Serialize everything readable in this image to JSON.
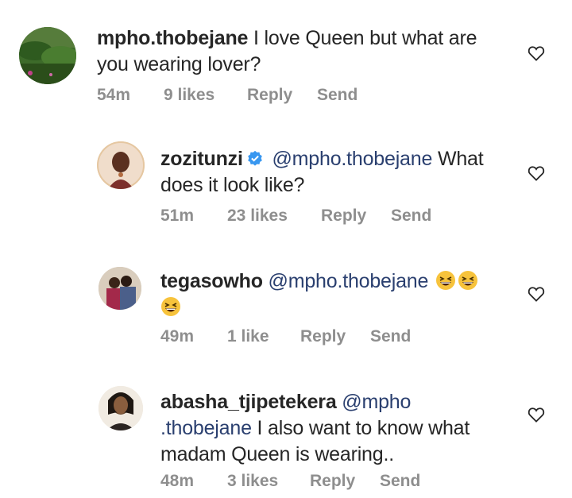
{
  "comments": [
    {
      "username": "mpho.thobejane",
      "text_line1": "I love Queen but what are",
      "text_line2": "you wearing lover?",
      "time": "54m",
      "likes": "9 likes",
      "reply": "Reply",
      "send": "Send"
    },
    {
      "username": "zozitunzi",
      "mention": "@mpho.thobejane",
      "text_line1": "What",
      "text_line2": "does it look like?",
      "time": "51m",
      "likes": "23 likes",
      "reply": "Reply",
      "send": "Send"
    },
    {
      "username": "tegasowho",
      "mention": "@mpho.thobejane",
      "emoji_name": "grinning-squinting-face",
      "time": "49m",
      "likes": "1 like",
      "reply": "Reply",
      "send": "Send"
    },
    {
      "username": "abasha_tjipetekera",
      "mention_part1": "@mpho",
      "mention_part2": ".thobejane",
      "text_line2": "I also want to know what",
      "text_line3": "madam Queen is wearing..",
      "time": "48m",
      "likes": "3 likes",
      "reply": "Reply",
      "send": "Send"
    }
  ],
  "icons": {
    "like": "heart-outline-icon",
    "verified": "verified-badge-icon",
    "verified_color": "#3897f0"
  }
}
